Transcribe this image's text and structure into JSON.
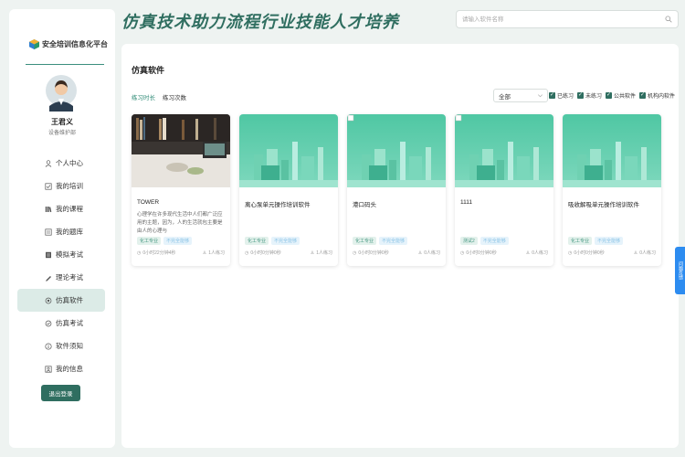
{
  "brand": {
    "name": "安全培训信息化平台"
  },
  "header": {
    "title": "仿真技术助力流程行业技能人才培养",
    "search_placeholder": "请输入软件名称"
  },
  "user": {
    "name": "王君义",
    "dept": "设备维护部"
  },
  "menu": [
    {
      "label": "个人中心",
      "icon": "user-icon"
    },
    {
      "label": "我的培训",
      "icon": "training-icon"
    },
    {
      "label": "我的课程",
      "icon": "course-icon"
    },
    {
      "label": "我的题库",
      "icon": "question-bank-icon"
    },
    {
      "label": "模拟考试",
      "icon": "mock-exam-icon"
    },
    {
      "label": "理论考试",
      "icon": "theory-exam-icon"
    },
    {
      "label": "仿真软件",
      "icon": "simulation-icon",
      "active": true
    },
    {
      "label": "仿真考试",
      "icon": "simulation-exam-icon"
    },
    {
      "label": "软件须知",
      "icon": "info-icon"
    },
    {
      "label": "我的信息",
      "icon": "profile-icon"
    }
  ],
  "logout_label": "退出登录",
  "main": {
    "title": "仿真软件",
    "sort": [
      "练习时长",
      "练习次数"
    ],
    "filter_select": "全部",
    "filters": [
      "已练习",
      "未练习",
      "公共软件",
      "机构内软件"
    ]
  },
  "cards": [
    {
      "title": "TOWER",
      "desc": "心理学在许多现代生活中人们都广泛应用的主题，因为，人的生活就包主要是由人的心理与",
      "tags": [
        "化工专业",
        "不完全能够"
      ],
      "time": "0小时22分钟4秒",
      "count": "1人练习"
    },
    {
      "title": "离心泵单元操作培训软件",
      "desc": "",
      "tags": [
        "化工专业",
        "不完全能够"
      ],
      "time": "0小时0分钟0秒",
      "count": "1人练习"
    },
    {
      "title": "港口码头",
      "desc": "",
      "tags": [
        "化工专业",
        "不完全能够"
      ],
      "time": "0小时0分钟0秒",
      "count": "0人练习"
    },
    {
      "title": "1111",
      "desc": "",
      "tags": [
        "测试2",
        "不完全能够"
      ],
      "time": "0小时0分钟0秒",
      "count": "0人练习"
    },
    {
      "title": "吸收解吸单元操作培训软件",
      "desc": "",
      "tags": [
        "化工专业",
        "不完全能够"
      ],
      "time": "0小时0分钟0秒",
      "count": "0人练习"
    }
  ],
  "fab_label": "问题反馈",
  "colors": {
    "primary": "#2f6e60",
    "accent": "#2f8b76",
    "fab": "#2d8cf0"
  }
}
